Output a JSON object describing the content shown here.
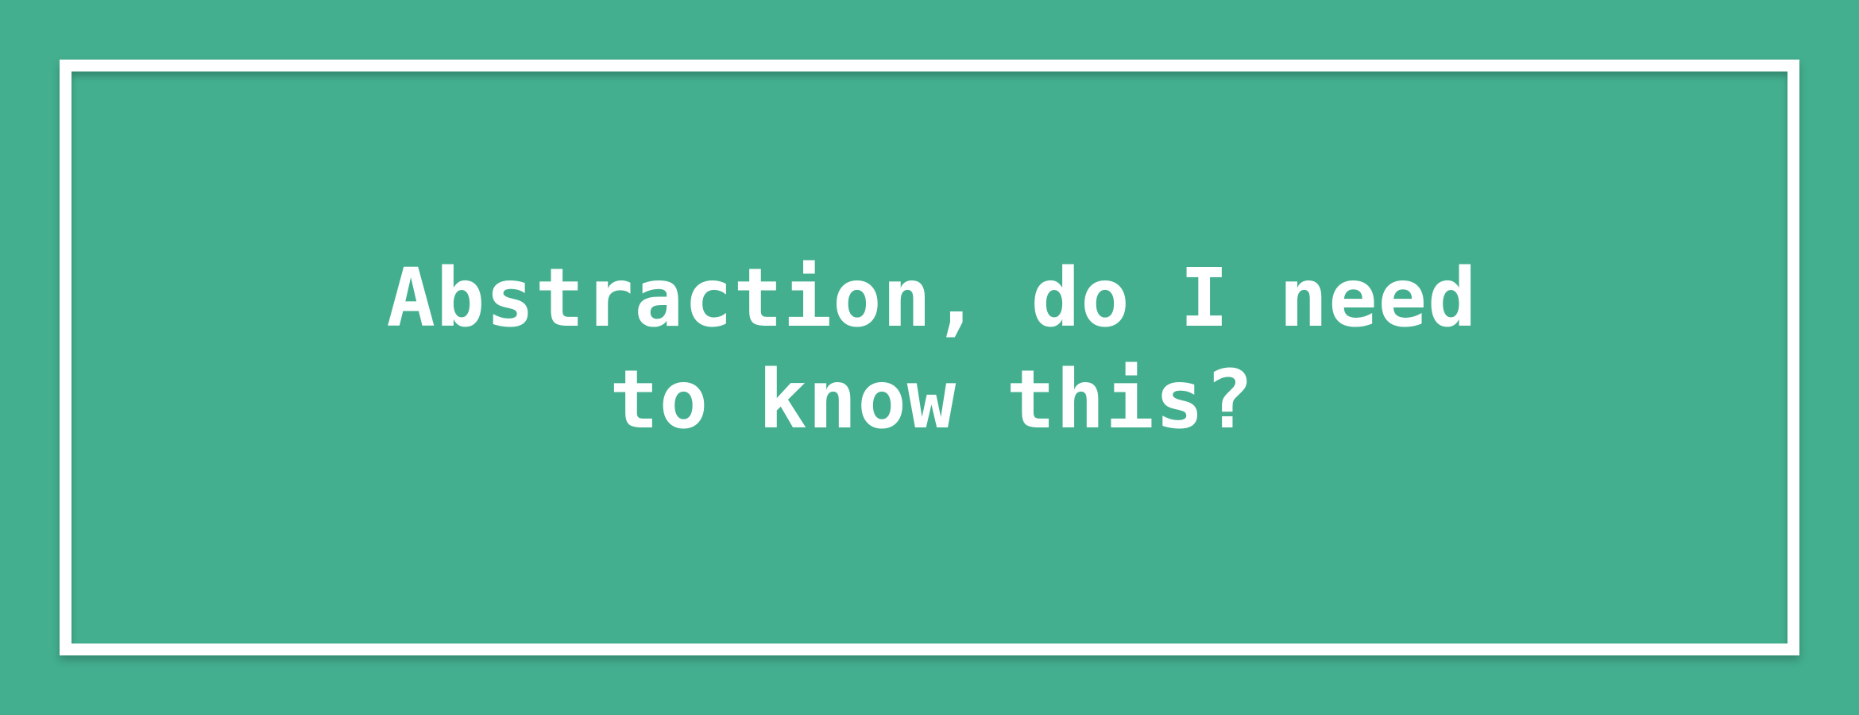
{
  "colors": {
    "background": "#43AF8F",
    "frame": "#FFFFFF",
    "text": "#FFFFFF"
  },
  "title": {
    "text": "Abstraction, do I need to know this?"
  }
}
